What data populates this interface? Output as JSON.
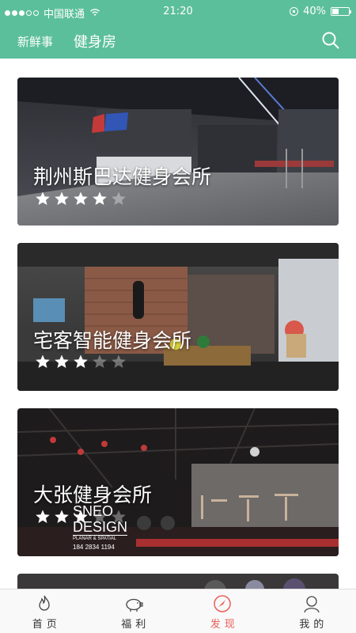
{
  "status_bar": {
    "carrier": "中国联通",
    "time": "21:20",
    "battery": "40%",
    "battery_level": 0.4
  },
  "nav": {
    "tab_new": "新鲜事",
    "tab_gym": "健身房"
  },
  "gyms": [
    {
      "name": "荆州斯巴达健身会所",
      "rating": 4
    },
    {
      "name": "宅客智能健身会所",
      "rating": 3
    },
    {
      "name": "大张健身会所",
      "rating": 3
    }
  ],
  "watermark": {
    "line1": "SNEO",
    "line2": "DESIGN",
    "line3": "PLANAR & SPATIAL",
    "line4": "184 2834 1194"
  },
  "tabs": [
    {
      "label": "首页",
      "icon": "flame-icon"
    },
    {
      "label": "福利",
      "icon": "piggy-bank-icon"
    },
    {
      "label": "发现",
      "icon": "compass-icon"
    },
    {
      "label": "我的",
      "icon": "person-icon"
    }
  ],
  "colors": {
    "primary": "#5cbf9c",
    "active_tab": "#e95f57"
  }
}
